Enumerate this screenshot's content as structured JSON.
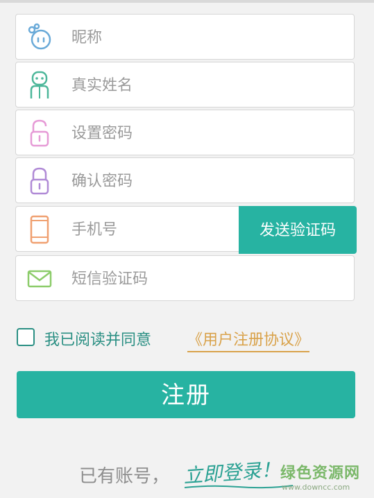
{
  "form": {
    "fields": [
      {
        "placeholder": "昵称",
        "icon": "face-icon",
        "color": "#6aaad8"
      },
      {
        "placeholder": "真实姓名",
        "icon": "person-icon",
        "color": "#4db79a"
      },
      {
        "placeholder": "设置密码",
        "icon": "unlock-icon",
        "color": "#e69ad6"
      },
      {
        "placeholder": "确认密码",
        "icon": "lock-icon",
        "color": "#b08ad6"
      },
      {
        "placeholder": "手机号",
        "icon": "phone-icon",
        "color": "#f0a070"
      },
      {
        "placeholder": "短信验证码",
        "icon": "mail-icon",
        "color": "#8ccc6a"
      }
    ],
    "send_code_label": "发送验证码"
  },
  "agreement": {
    "text": "我已阅读并同意",
    "link": "《用户注册协议》",
    "checked": false
  },
  "register_label": "注册",
  "login": {
    "prefix": "已有账号，",
    "link": "立即登录！"
  },
  "watermark": {
    "cn": "绿色资源网",
    "en": "www.downcc.com"
  },
  "colors": {
    "accent": "#27b3a2",
    "link": "#d9a24a",
    "background": "#f2f2f2"
  }
}
